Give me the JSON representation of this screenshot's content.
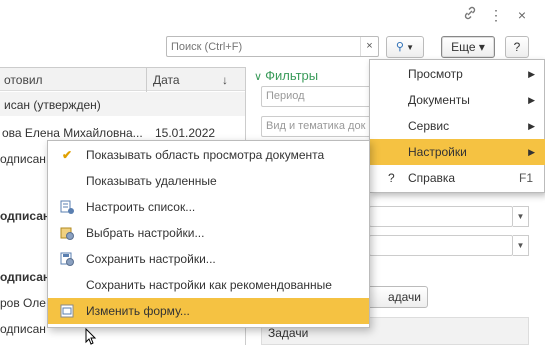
{
  "window_controls": {
    "link_icon": "link-icon",
    "more_icon": "kebab-icon",
    "close_icon": "close-icon"
  },
  "search": {
    "placeholder": "Поиск (Ctrl+F)",
    "clear_label": "×"
  },
  "toolbar": {
    "search_button_label": "🔍 ▾",
    "more_label": "Еще ▾",
    "help_label": "?"
  },
  "table": {
    "col_author": "отовил",
    "col_date": "Дата",
    "sort_indicator": "↓",
    "rows": [
      "исан (утвержден)",
      "ова Елена Михайловна...",
      "одписан",
      "одписан",
      "одписан",
      "ров Оле",
      "одписан"
    ],
    "row_date": "15.01.2022"
  },
  "filters": {
    "title": "Фильтры",
    "period_placeholder": "Период",
    "theme_placeholder": "Вид и тематика док",
    "tasks_button": "адачи",
    "tasks_header": "Задачи"
  },
  "menu_more": {
    "items": [
      {
        "label": "Просмотр",
        "shortcut": ""
      },
      {
        "label": "Документы",
        "shortcut": ""
      },
      {
        "label": "Сервис",
        "shortcut": ""
      },
      {
        "label": "Настройки",
        "shortcut": ""
      },
      {
        "label": "Справка",
        "shortcut": "F1"
      }
    ]
  },
  "submenu": {
    "items": [
      {
        "label": "Показывать область просмотра документа",
        "icon": "checkmark-icon"
      },
      {
        "label": "Показывать удаленные",
        "icon": ""
      },
      {
        "label": "Настроить список...",
        "icon": "list-settings-icon"
      },
      {
        "label": "Выбрать настройки...",
        "icon": "choose-settings-icon"
      },
      {
        "label": "Сохранить настройки...",
        "icon": "save-settings-icon"
      },
      {
        "label": "Сохранить настройки как рекомендованные",
        "icon": ""
      },
      {
        "label": "Изменить форму...",
        "icon": "edit-form-icon"
      }
    ]
  },
  "colors": {
    "highlight": "#f5c242",
    "filters_title": "#3a9b5a",
    "check_color": "#e0a000"
  }
}
